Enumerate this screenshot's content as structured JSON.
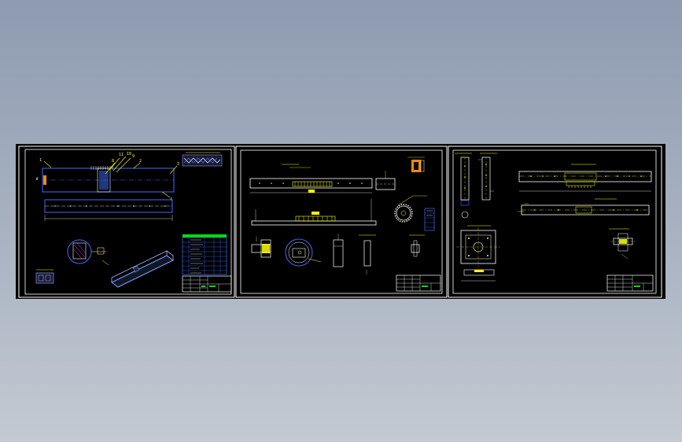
{
  "viewport": {
    "background": "#000000",
    "sheet_border_color": "#ffffff",
    "inner_frame_color": "#ffffff"
  },
  "colors": {
    "yellow": "#ffff00",
    "blue": "#3f6cff",
    "cyan": "#00c8ff",
    "white": "#ffffff",
    "green": "#00e000",
    "orange": "#ff8a00",
    "magenta": "#ff40ff",
    "red": "#ff3030"
  },
  "sheets": [
    {
      "name": "assembly-drawing"
    },
    {
      "name": "part-drawing-rack"
    },
    {
      "name": "part-drawing-base"
    }
  ]
}
